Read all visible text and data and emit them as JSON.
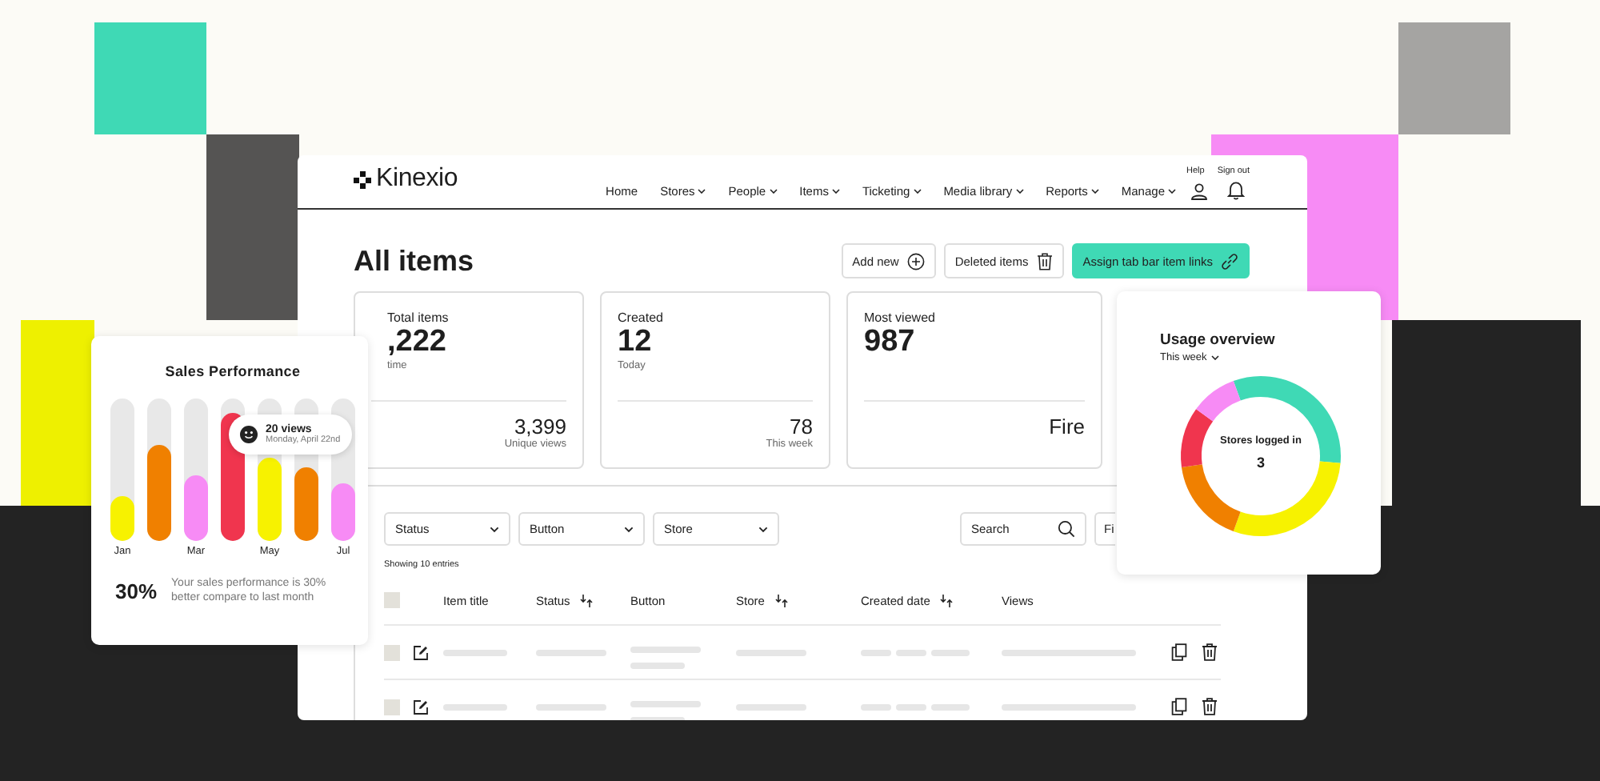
{
  "header": {
    "logo": "Kinexio",
    "top_links": [
      "Help",
      "Sign out"
    ],
    "nav": [
      {
        "label": "Home",
        "dropdown": false
      },
      {
        "label": "Stores",
        "dropdown": true
      },
      {
        "label": "People",
        "dropdown": true
      },
      {
        "label": "Items",
        "dropdown": true
      },
      {
        "label": "Ticketing",
        "dropdown": true
      },
      {
        "label": "Media library",
        "dropdown": true
      },
      {
        "label": "Reports",
        "dropdown": true
      },
      {
        "label": "Manage",
        "dropdown": true
      }
    ]
  },
  "page": {
    "title": "All items",
    "actions": [
      {
        "label": "Add new",
        "kind": "add",
        "primary": false
      },
      {
        "label": "Deleted items",
        "kind": "deleted",
        "primary": false
      },
      {
        "label": "Assign tab bar item links",
        "kind": "assign",
        "primary": true
      }
    ]
  },
  "stats": [
    {
      "label": "Total items",
      "value": ",222",
      "caption": "time",
      "secondary_value": "3,399",
      "secondary_caption": "Unique views"
    },
    {
      "label": "Created",
      "value": "12",
      "caption": "Today",
      "secondary_value": "78",
      "secondary_caption": "This week"
    },
    {
      "label": "Most viewed",
      "value": "987",
      "secondary_value": "Fire"
    }
  ],
  "filters": [
    {
      "label": "Status"
    },
    {
      "label": "Button"
    },
    {
      "label": "Store"
    }
  ],
  "search": {
    "placeholder": "Search"
  },
  "filter_button": "Fi",
  "entries": "Showing 10 entries",
  "table": {
    "columns": [
      {
        "label": "Item title",
        "sortable": false
      },
      {
        "label": "Status",
        "sortable": true
      },
      {
        "label": "Button",
        "sortable": false
      },
      {
        "label": "Store",
        "sortable": true
      },
      {
        "label": "Created date",
        "sortable": true
      },
      {
        "label": "Views",
        "sortable": false
      }
    ],
    "header_checked": false,
    "rows": [
      {
        "checked": false
      },
      {
        "checked": false
      }
    ]
  },
  "sales": {
    "title": "Sales Performance",
    "bars": [
      {
        "label": "Jan",
        "color": "#f7f200",
        "level": 0.32
      },
      {
        "color": "#f08000",
        "level": 0.67
      },
      {
        "label": "Mar",
        "color": "#f78bf5",
        "level": 0.46
      },
      {
        "color": "#f0354e",
        "level": 0.9
      },
      {
        "label": "May",
        "color": "#f7f200",
        "level": 0.59
      },
      {
        "color": "#f08000",
        "level": 0.52
      },
      {
        "label": "Jul",
        "color": "#f78bf5",
        "level": 0.41
      }
    ],
    "tooltip": {
      "title": "20 views",
      "subtitle": "Monday, April 22nd"
    },
    "percent": "30%",
    "note": "Your sales performance is 30% better compare to last month"
  },
  "usage": {
    "title": "Usage overview",
    "period": "This week",
    "center_label": "Stores logged in",
    "center_value": "3"
  }
}
